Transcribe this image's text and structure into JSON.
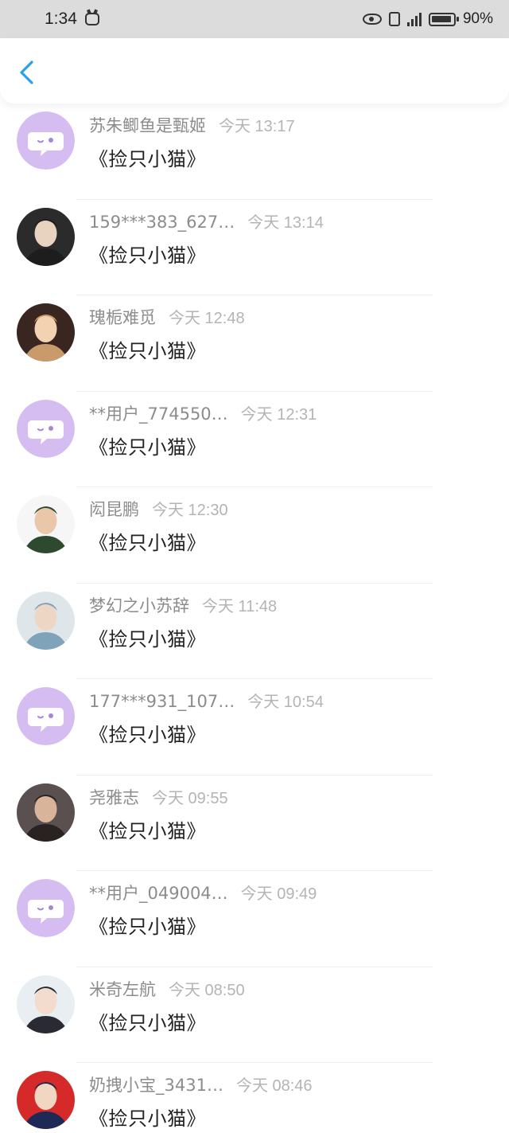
{
  "status_bar": {
    "time": "1:34",
    "battery": "90%",
    "network": "4G"
  },
  "header": {
    "back_icon": "chevron-left-icon",
    "accent_color": "#2aa1ef"
  },
  "messages": [
    {
      "name": "苏朱鲫鱼是甄姬",
      "time": "今天 13:17",
      "text": "《捡只小猫》",
      "avatar": "default-chat-avatar"
    },
    {
      "name": "159***383_627…",
      "time": "今天 13:14",
      "text": "《捡只小猫》",
      "avatar": "user-photo-avatar"
    },
    {
      "name": "瑰栀难觅",
      "time": "今天 12:48",
      "text": "《捡只小猫》",
      "avatar": "user-photo-avatar"
    },
    {
      "name": "**用户_774550…",
      "time": "今天 12:31",
      "text": "《捡只小猫》",
      "avatar": "default-chat-avatar"
    },
    {
      "name": "闳昆鹏",
      "time": "今天 12:30",
      "text": "《捡只小猫》",
      "avatar": "user-photo-avatar"
    },
    {
      "name": "梦幻之小苏辞",
      "time": "今天 11:48",
      "text": "《捡只小猫》",
      "avatar": "user-photo-avatar"
    },
    {
      "name": "177***931_107…",
      "time": "今天 10:54",
      "text": "《捡只小猫》",
      "avatar": "default-chat-avatar"
    },
    {
      "name": "尧雅志",
      "time": "今天 09:55",
      "text": "《捡只小猫》",
      "avatar": "user-photo-avatar"
    },
    {
      "name": "**用户_049004…",
      "time": "今天 09:49",
      "text": "《捡只小猫》",
      "avatar": "default-chat-avatar"
    },
    {
      "name": "米奇左航",
      "time": "今天 08:50",
      "text": "《捡只小猫》",
      "avatar": "user-photo-avatar"
    },
    {
      "name": "奶拽小宝_3431…",
      "time": "今天 08:46",
      "text": "《捡只小猫》",
      "avatar": "user-photo-avatar"
    }
  ]
}
